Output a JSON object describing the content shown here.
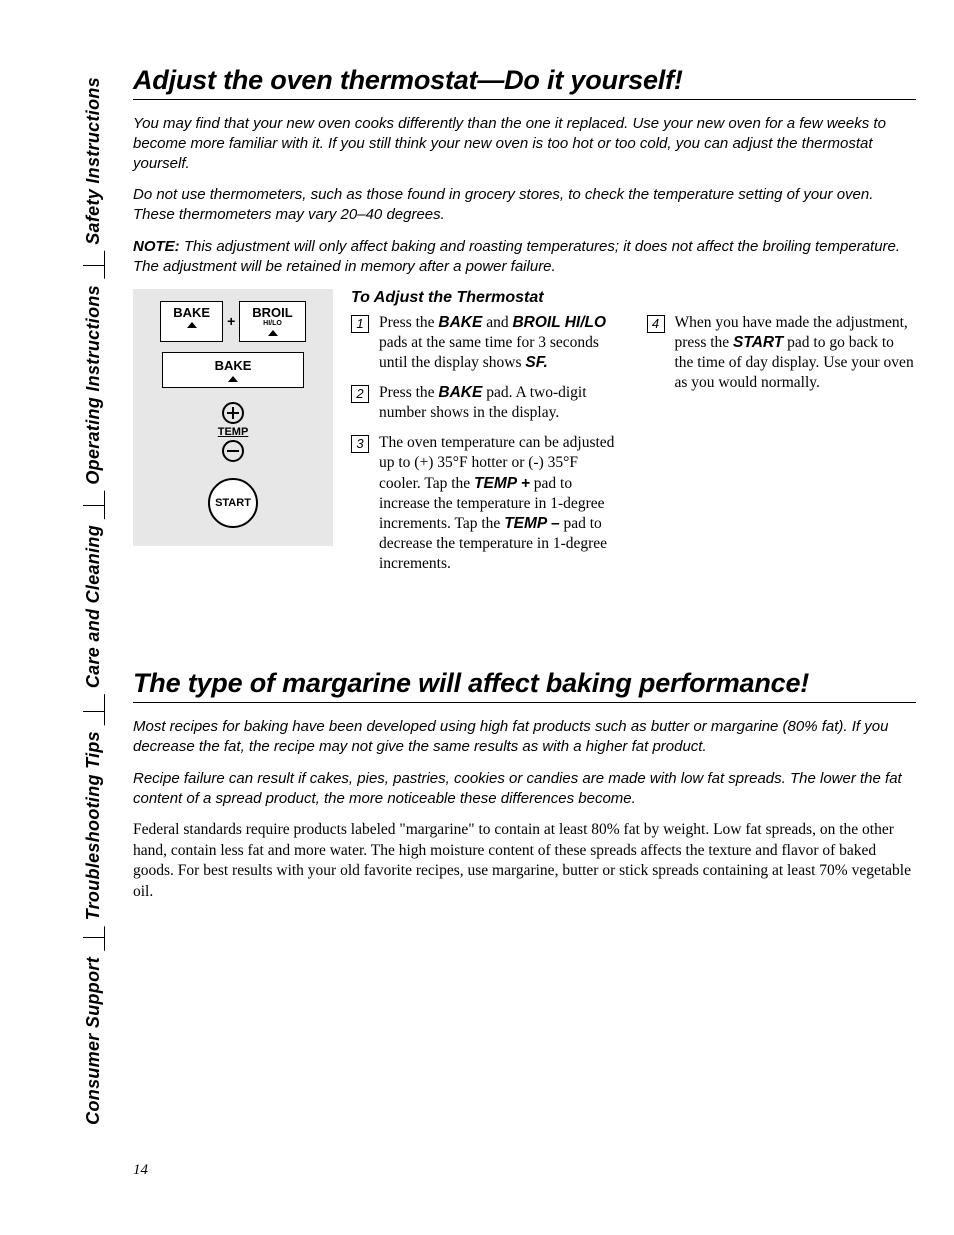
{
  "tabs": {
    "safety": "Safety Instructions",
    "operating": "Operating Instructions",
    "care": "Care and Cleaning",
    "trouble": "Troubleshooting Tips",
    "support": "Consumer Support"
  },
  "section1": {
    "title": "Adjust the oven thermostat—Do it yourself!",
    "intro1": "You may find that your new oven cooks differently than the one it replaced. Use your new oven for a few weeks to become more familiar with it. If you still think your new oven is too hot or too cold, you can adjust the thermostat yourself.",
    "intro2": "Do not use thermometers, such as those found in grocery stores, to check the temperature setting of your oven. These thermometers may vary 20–40 degrees.",
    "note_label": "NOTE:",
    "note_body": " This adjustment will only affect baking and roasting temperatures; it does not affect the broiling temperature. The adjustment will be retained in memory after a power failure.",
    "subhead": "To Adjust the Thermostat",
    "panel": {
      "bake": "BAKE",
      "broil": "BROIL",
      "broil_sub": "HI/LO",
      "plus": "+",
      "temp": "TEMP",
      "start": "START"
    },
    "steps": {
      "s1_a": "Press the ",
      "s1_b": "BAKE",
      "s1_c": " and ",
      "s1_d": "BROIL HI/LO",
      "s1_e": " pads at the same time for 3 seconds until the display shows ",
      "s1_f": "SF.",
      "s2_a": "Press the ",
      "s2_b": "BAKE",
      "s2_c": " pad. A two-digit number shows in the display.",
      "s3_a": "The oven temperature can be adjusted up to (+) 35°F hotter or (-) 35°F cooler. Tap the ",
      "s3_b": "TEMP +",
      "s3_c": " pad to increase the temperature in 1-degree increments. Tap the ",
      "s3_d": "TEMP –",
      "s3_e": " pad to decrease the temperature in 1-degree increments.",
      "s4_a": "When you have made the adjustment, press the ",
      "s4_b": "START",
      "s4_c": " pad to go back to the time of day display. Use your oven as you would normally.",
      "n1": "1",
      "n2": "2",
      "n3": "3",
      "n4": "4"
    }
  },
  "section2": {
    "title": "The type of margarine will affect baking performance!",
    "intro1": "Most recipes for baking have been developed using high fat products such as butter or margarine (80% fat). If you decrease the fat, the recipe may not give the same results as with a higher fat product.",
    "intro2": "Recipe failure can result if cakes, pies, pastries, cookies or candies are made with low fat spreads. The lower the fat content of a spread product, the more noticeable these differences become.",
    "body": "Federal standards require products labeled \"margarine\" to contain at least 80% fat by weight. Low fat spreads, on the other hand, contain less fat and more water. The high moisture content of these spreads affects the texture and flavor of baked goods. For best results with your old favorite recipes, use margarine, butter or stick spreads containing at least 70% vegetable oil."
  },
  "page_number": "14"
}
